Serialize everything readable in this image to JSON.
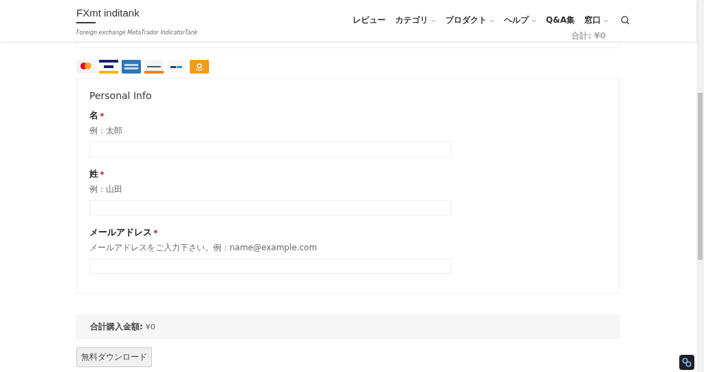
{
  "site": {
    "title": "FXmt inditank",
    "tagline": "Foreign exchange MetaTrador IndicatorTank"
  },
  "nav": [
    {
      "label": "レビュー",
      "dropdown": false
    },
    {
      "label": "カテゴリ",
      "dropdown": true
    },
    {
      "label": "プロダクト",
      "dropdown": true
    },
    {
      "label": "ヘルプ",
      "dropdown": true
    },
    {
      "label": "Q&A集",
      "dropdown": false
    },
    {
      "label": "窓口",
      "dropdown": true
    }
  ],
  "cart_total_behind": "合計: ¥0",
  "payment_logos": [
    {
      "kind": "mastercard"
    },
    {
      "kind": "visa"
    },
    {
      "kind": "amex"
    },
    {
      "kind": "discover"
    },
    {
      "kind": "paypal"
    },
    {
      "kind": "amazon"
    }
  ],
  "form": {
    "title": "Personal Info",
    "fields": [
      {
        "label": "名",
        "required_mark": "*",
        "hint": "例：太郎"
      },
      {
        "label": "姓",
        "required_mark": "*",
        "hint": "例：山田"
      },
      {
        "label": "メールアドレス",
        "required_mark": "*",
        "hint": "メールアドレスをご入力下さい。例：name@example.com"
      }
    ]
  },
  "total": {
    "label": "合計購入金額:",
    "value": "¥0"
  },
  "button": "無料ダウンロード"
}
